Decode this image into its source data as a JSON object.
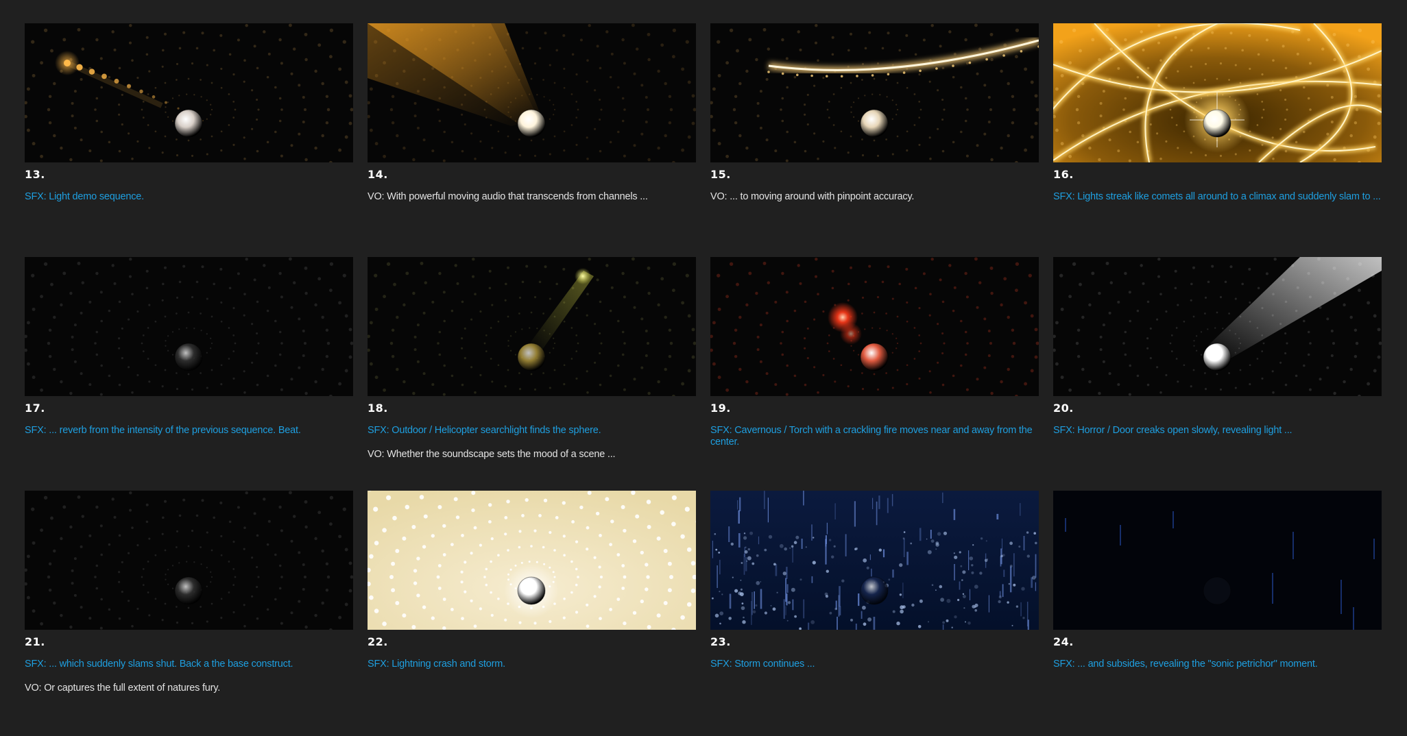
{
  "panels": [
    {
      "number": "13.",
      "captions": [
        {
          "kind": "sfx",
          "text": "SFX: Light demo sequence."
        }
      ],
      "scene": "orb-comet-trail",
      "colors": {
        "glow": "#ffb94a",
        "orb": "#d8cfc8"
      }
    },
    {
      "number": "14.",
      "captions": [
        {
          "kind": "vo",
          "text": "VO: With powerful moving audio that transcends from channels ..."
        }
      ],
      "scene": "orb-spotlight",
      "colors": {
        "glow": "#e89a22",
        "orb": "#fff4dc"
      }
    },
    {
      "number": "15.",
      "captions": [
        {
          "kind": "vo",
          "text": "VO: ... to moving around with pinpoint accuracy."
        }
      ],
      "scene": "orb-light-streak",
      "colors": {
        "glow": "#ffd27a",
        "orb": "#e7d6b8"
      }
    },
    {
      "number": "16.",
      "captions": [
        {
          "kind": "sfx",
          "text": "SFX: Lights streak like comets all around to a climax and suddenly slam to ..."
        }
      ],
      "scene": "orb-climax-streaks",
      "colors": {
        "glow": "#f3a21a",
        "orb": "#fffbe8"
      }
    },
    {
      "number": "17.",
      "captions": [
        {
          "kind": "sfx",
          "text": "SFX: ... reverb from the intensity of the previous sequence. Beat."
        }
      ],
      "scene": "orb-dim",
      "colors": {
        "glow": "#333333",
        "orb": "#3a3a3a"
      }
    },
    {
      "number": "18.",
      "captions": [
        {
          "kind": "sfx",
          "text": "SFX: Outdoor / Helicopter searchlight finds the sphere."
        },
        {
          "kind": "vo",
          "text": "VO: Whether the soundscape sets the mood of a scene ..."
        }
      ],
      "scene": "orb-searchlight",
      "colors": {
        "glow": "#d8d84a",
        "orb": "#c2a642"
      }
    },
    {
      "number": "19.",
      "captions": [
        {
          "kind": "sfx",
          "text": "SFX: Cavernous / Torch with a crackling fire moves near and away from the center."
        }
      ],
      "scene": "orb-torch",
      "colors": {
        "glow": "#ff3a1a",
        "orb": "#e05a40"
      }
    },
    {
      "number": "20.",
      "captions": [
        {
          "kind": "sfx",
          "text": "SFX: Horror / Door creaks open slowly, revealing light ..."
        }
      ],
      "scene": "orb-door-light",
      "colors": {
        "glow": "#ffffff",
        "orb": "#ffffff"
      }
    },
    {
      "number": "21.",
      "captions": [
        {
          "kind": "sfx",
          "text": "SFX: ... which suddenly slams shut. Back a the base construct."
        },
        {
          "kind": "vo",
          "text": "VO: Or captures the full extent of natures fury."
        }
      ],
      "scene": "orb-dim",
      "colors": {
        "glow": "#333333",
        "orb": "#3a3a3a"
      }
    },
    {
      "number": "22.",
      "captions": [
        {
          "kind": "sfx",
          "text": "SFX: Lightning crash and storm."
        }
      ],
      "scene": "orb-lightning-flash",
      "colors": {
        "glow": "#f3e8c8",
        "orb": "#ffffff"
      }
    },
    {
      "number": "23.",
      "captions": [
        {
          "kind": "sfx",
          "text": "SFX: Storm continues ..."
        }
      ],
      "scene": "orb-storm",
      "colors": {
        "glow": "#2a4d9a",
        "orb": "#1a2a55"
      }
    },
    {
      "number": "24.",
      "captions": [
        {
          "kind": "sfx",
          "text": "SFX: ... and subsides, revealing the \"sonic petrichor\" moment."
        }
      ],
      "scene": "orb-petrichor",
      "colors": {
        "glow": "#1a3a8a",
        "orb": "#111522"
      }
    }
  ]
}
